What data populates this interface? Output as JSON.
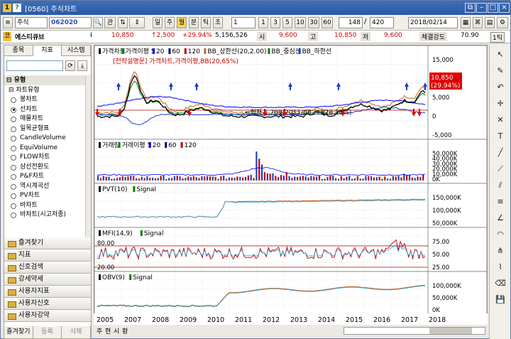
{
  "window": {
    "title": "[0560] 주식차트",
    "icon_a": "1",
    "icon_b": "?"
  },
  "toolbar": {
    "market": "주식",
    "code": "062020",
    "periods": [
      "일",
      "주",
      "월",
      "분",
      "틱",
      "초"
    ],
    "selected_period": "월",
    "interval_value": "1",
    "intervals": [
      "1",
      "3",
      "5",
      "10",
      "30",
      "60"
    ],
    "count": "148",
    "total": "420",
    "date": "2018/02/14",
    "slash": "/"
  },
  "info": {
    "stock_name": "에스티큐브",
    "market_badge": "코",
    "info_icon": "i",
    "price": "10,850",
    "change": "↑2,500",
    "change_pct": "+29.94%",
    "volume": "5,156,526",
    "open_label": "시",
    "open": "9,600",
    "high_label": "고",
    "high": "10,850",
    "low_label": "저",
    "low": "9,600",
    "strength_label": "체결강도",
    "strength": "70.90",
    "tick_button": "1틱"
  },
  "left_panel": {
    "tabs": [
      "종목",
      "지표",
      "시스템"
    ],
    "active_tab": "지표",
    "tree_group": "유형",
    "tree_subgroup": "차트유형",
    "items": [
      "봉차트",
      "선차트",
      "매물차트",
      "일목균형표",
      "CandleVolume",
      "EquiVolume",
      "FLOW차트",
      "삼선전환도",
      "P&F차트",
      "역시계곡선",
      "PV차트",
      "바차트",
      "바차트(시고저종)"
    ],
    "selected_item": "선차트",
    "folders": [
      "즐겨찾기",
      "지표",
      "신호검색",
      "강세약세",
      "사용자지표",
      "사용자신호",
      "사용자강약"
    ],
    "bottom_tabs": [
      "즐겨찾기",
      "등록",
      "삭제"
    ]
  },
  "panels": [
    {
      "legend": [
        "가격차트",
        "가격이평 5",
        "20",
        "60",
        "120",
        "BB_상한선(20,2.00)",
        "BB_중심선",
        "BB_하한선"
      ],
      "annotation": "[전략설명문] 가격차트,가격이평,BB(20,65%)",
      "min_note": "←최저 1,709(2011/08, +828.14%)",
      "price_tag": "10,850",
      "pct_tag": "(29.94%)",
      "yticks": [
        "15,000",
        "10,000",
        "5,000",
        "0",
        "-5,000"
      ]
    },
    {
      "legend": [
        "거래량",
        "거래이평 5",
        "20",
        "60",
        "120"
      ],
      "yticks": [
        "50,000K",
        "40,000K",
        "30,000K",
        "20,000K",
        "10,000K",
        "0K"
      ]
    },
    {
      "legend": [
        "PVT(10)",
        "Signal"
      ],
      "yticks": [
        "150,000K",
        "100,000K",
        "50,000K"
      ]
    },
    {
      "legend": [
        "MFI(14,9)",
        "Signal"
      ],
      "top_label": "80.00",
      "bottom_label": "20.00",
      "yticks": [
        "75.00",
        "50.00",
        "25.00"
      ]
    },
    {
      "legend": [
        "OBV(9)",
        "Signal"
      ],
      "yticks": [
        "100,000K",
        "50,000K",
        "0K"
      ]
    }
  ],
  "xaxis": [
    "2005",
    "2007",
    "2008",
    "2009",
    "2010",
    "2011",
    "2012",
    "2013",
    "2014",
    "2015",
    "2016",
    "2017",
    "2018"
  ],
  "status": {
    "left": "주",
    "mid": "현",
    "right": "시",
    "end": "황"
  },
  "colors": {
    "title_bg": "#2a5aa6",
    "price_line": "#000000",
    "ma5": "#008000",
    "ma20": "#0000ff",
    "ma60": "#000080",
    "ma120": "#c00000",
    "bb_upper": "#c8641e",
    "bb_mid": "#008000",
    "bb_lower": "#1e3cc8",
    "buy_signal": "#e00000",
    "sell_signal": "#1e3cc8"
  },
  "icons": [
    "pointer-icon",
    "zoom-icon",
    "undo-icon",
    "crosshair-icon",
    "delete-icon",
    "text-icon",
    "line-icon",
    "trend-line-icon",
    "channel-icon",
    "fib-icon",
    "gann-icon",
    "cycle-icon",
    "andrews-icon",
    "pattern-icon",
    "eraser-icon",
    "save-icon"
  ]
}
